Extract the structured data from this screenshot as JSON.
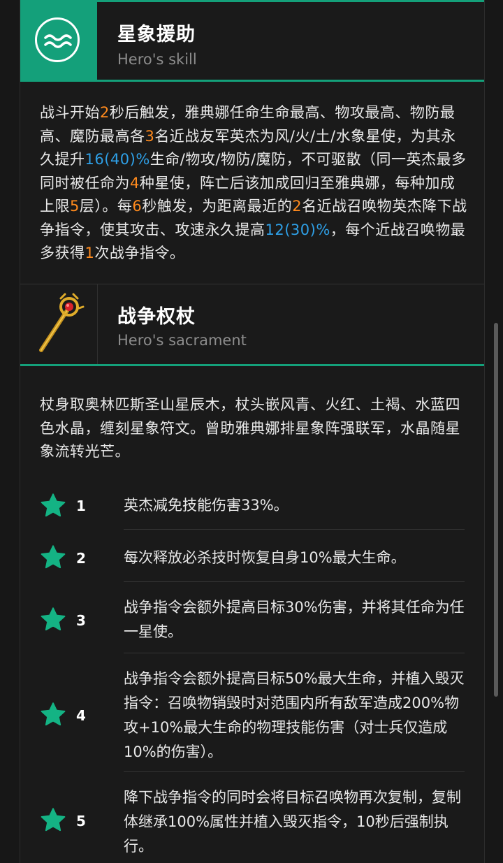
{
  "skill": {
    "title": "星象援助",
    "subtitle": "Hero's skill",
    "icon": "waves-icon",
    "desc": [
      {
        "t": "战斗开始"
      },
      {
        "t": "2",
        "c": "o"
      },
      {
        "t": "秒后触发，雅典娜任命生命最高、物攻最高、物防最高、魔防最高各"
      },
      {
        "t": "3",
        "c": "o"
      },
      {
        "t": "名近战友军英杰为风/火/土/水象星使，为其永久提升"
      },
      {
        "t": "16(40)%",
        "c": "b"
      },
      {
        "t": "生命/物攻/物防/魔防，不可驱散（同一英杰最多同时被任命为"
      },
      {
        "t": "4",
        "c": "o"
      },
      {
        "t": "种星使，阵亡后该加成回归至雅典娜，每种加成上限"
      },
      {
        "t": "5",
        "c": "o"
      },
      {
        "t": "层）。每"
      },
      {
        "t": "6",
        "c": "o"
      },
      {
        "t": "秒触发，为距离最近的"
      },
      {
        "t": "2",
        "c": "o"
      },
      {
        "t": "名近战召唤物英杰降下战争指令，使其攻击、攻速永久提高"
      },
      {
        "t": "12(30)%",
        "c": "b"
      },
      {
        "t": "，每个近战召唤物最多获得"
      },
      {
        "t": "1",
        "c": "o"
      },
      {
        "t": "次战争指令。"
      }
    ]
  },
  "sacrament": {
    "title": "战争权杖",
    "subtitle": "Hero's sacrament",
    "icon": "scepter-icon",
    "desc": "杖身取奥林匹斯圣山星辰木，杖头嵌风青、火红、土褐、水蓝四色水晶，缠刻星象符文。曾助雅典娜排星象阵强联军，水晶随星象流转光芒。"
  },
  "stars": [
    {
      "num": "1",
      "text": "英杰减免技能伤害33%。"
    },
    {
      "num": "2",
      "text": "每次释放必杀技时恢复自身10%最大生命。"
    },
    {
      "num": "3",
      "text": "战争指令会额外提高目标30%伤害，并将其任命为任一星使。"
    },
    {
      "num": "4",
      "text": "战争指令会额外提高目标50%最大生命，并植入毁灭指令：召唤物销毁时对范围内所有敌军造成200%物攻+10%最大生命的物理技能伤害（对士兵仅造成10%的伤害）。"
    },
    {
      "num": "5",
      "text": "降下战争指令的同时会将目标召唤物再次复制，复制体继承100%属性并植入毁灭指令，10秒后强制执行。"
    }
  ],
  "colors": {
    "accent": "#14a07a",
    "orange": "#ff8a1d",
    "blue": "#2e9fe6"
  }
}
